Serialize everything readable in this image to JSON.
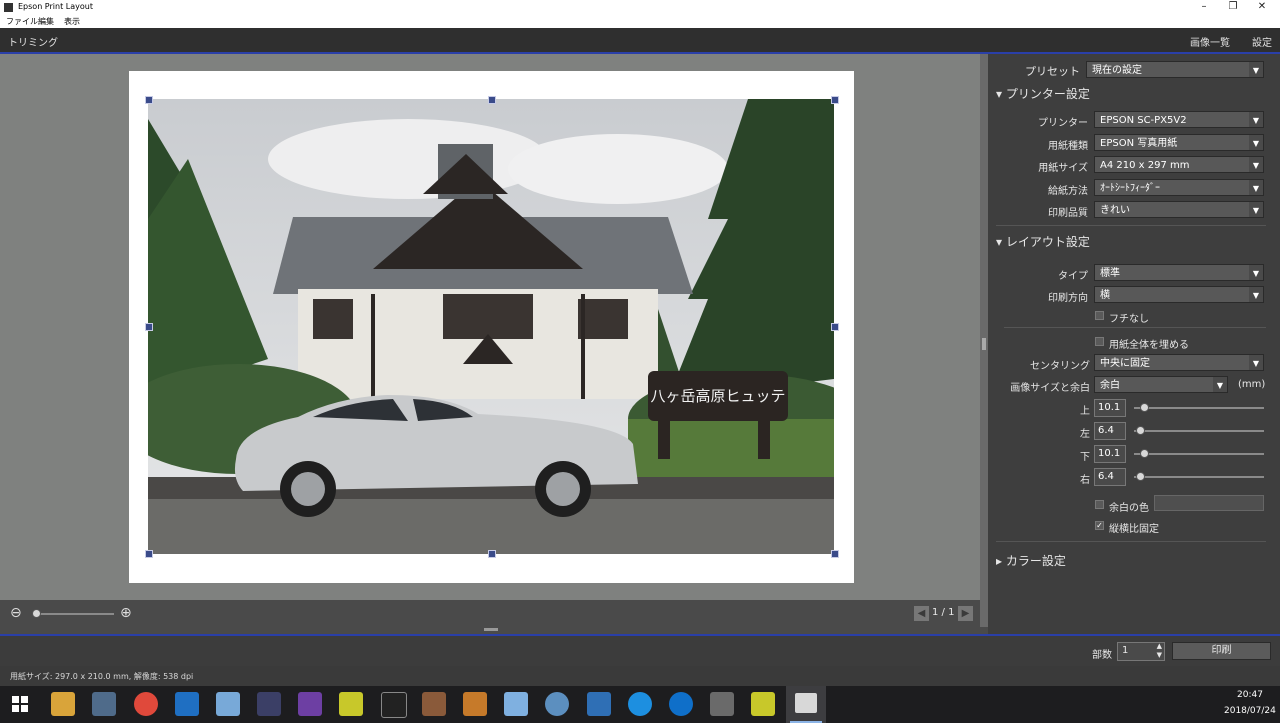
{
  "window": {
    "title": "Epson Print Layout",
    "menu": [
      "ファイル",
      "編集",
      "表示"
    ]
  },
  "header": {
    "mode": "トリミング",
    "gallery": "画像一覧",
    "settings": "設定"
  },
  "zoom": {
    "page_indicator": "1 / 1"
  },
  "panel": {
    "preset_label": "プリセット",
    "preset_value": "現在の設定",
    "printer_section": "プリンター設定",
    "printer_label": "プリンター",
    "printer_value": "EPSON SC-PX5V2",
    "paper_type_label": "用紙種類",
    "paper_type_value": "EPSON 写真用紙",
    "paper_size_label": "用紙サイズ",
    "paper_size_value": "A4 210 x 297 mm",
    "feed_label": "給紙方法",
    "feed_value": "ｵｰﾄｼｰﾄﾌｨｰﾀﾞｰ",
    "quality_label": "印刷品質",
    "quality_value": "きれい",
    "layout_section": "レイアウト設定",
    "type_label": "タイプ",
    "type_value": "標準",
    "orient_label": "印刷方向",
    "orient_value": "横",
    "borderless_label": "フチなし",
    "fill_label": "用紙全体を埋める",
    "center_label": "センタリング",
    "center_value": "中央に固定",
    "imgsize_label": "画像サイズと余白",
    "imgsize_value": "余白",
    "unit": "(mm)",
    "margins": [
      {
        "label": "上",
        "value": "10.1"
      },
      {
        "label": "左",
        "value": "6.4"
      },
      {
        "label": "下",
        "value": "10.1"
      },
      {
        "label": "右",
        "value": "6.4"
      }
    ],
    "margin_color_label": "余白の色",
    "aspect_label": "縦横比固定",
    "aspect_checked": "✓",
    "color_section": "カラー設定"
  },
  "bottom": {
    "copies_label": "部数",
    "copies_value": "1",
    "print_button": "印刷"
  },
  "status": {
    "text": "用紙サイズ: 297.0 x 210.0 mm,  解像度: 538 dpi"
  },
  "taskbar": {
    "time": "20:47",
    "date": "2018/07/24"
  },
  "photo_sign": "八ヶ岳高原ヒュッテ",
  "colors": {
    "accent": "#2a3fa8",
    "panel": "#3e3e3e",
    "canvas": "#7f817f"
  }
}
